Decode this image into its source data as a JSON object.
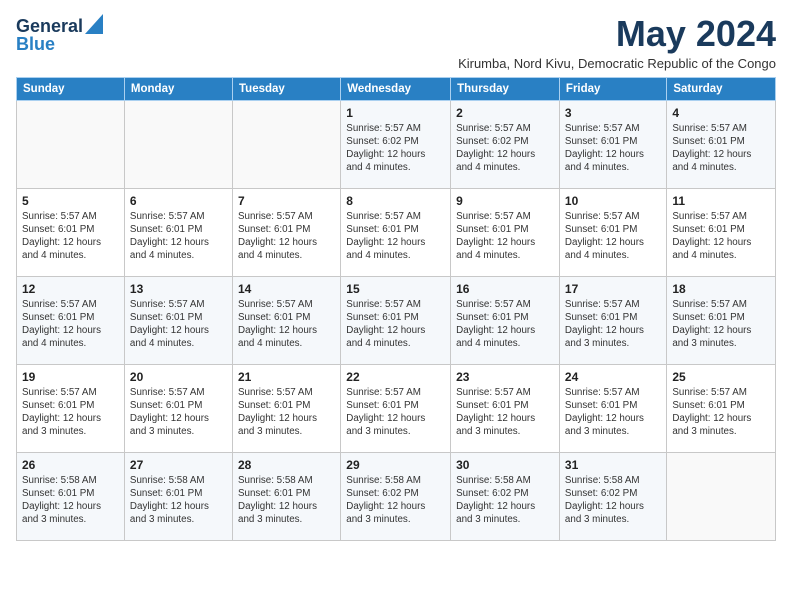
{
  "logo": {
    "general": "General",
    "blue": "Blue"
  },
  "title": "May 2024",
  "location": "Kirumba, Nord Kivu, Democratic Republic of the Congo",
  "days_of_week": [
    "Sunday",
    "Monday",
    "Tuesday",
    "Wednesday",
    "Thursday",
    "Friday",
    "Saturday"
  ],
  "weeks": [
    [
      {
        "day": "",
        "info": ""
      },
      {
        "day": "",
        "info": ""
      },
      {
        "day": "",
        "info": ""
      },
      {
        "day": "1",
        "info": "Sunrise: 5:57 AM\nSunset: 6:02 PM\nDaylight: 12 hours\nand 4 minutes."
      },
      {
        "day": "2",
        "info": "Sunrise: 5:57 AM\nSunset: 6:02 PM\nDaylight: 12 hours\nand 4 minutes."
      },
      {
        "day": "3",
        "info": "Sunrise: 5:57 AM\nSunset: 6:01 PM\nDaylight: 12 hours\nand 4 minutes."
      },
      {
        "day": "4",
        "info": "Sunrise: 5:57 AM\nSunset: 6:01 PM\nDaylight: 12 hours\nand 4 minutes."
      }
    ],
    [
      {
        "day": "5",
        "info": "Sunrise: 5:57 AM\nSunset: 6:01 PM\nDaylight: 12 hours\nand 4 minutes."
      },
      {
        "day": "6",
        "info": "Sunrise: 5:57 AM\nSunset: 6:01 PM\nDaylight: 12 hours\nand 4 minutes."
      },
      {
        "day": "7",
        "info": "Sunrise: 5:57 AM\nSunset: 6:01 PM\nDaylight: 12 hours\nand 4 minutes."
      },
      {
        "day": "8",
        "info": "Sunrise: 5:57 AM\nSunset: 6:01 PM\nDaylight: 12 hours\nand 4 minutes."
      },
      {
        "day": "9",
        "info": "Sunrise: 5:57 AM\nSunset: 6:01 PM\nDaylight: 12 hours\nand 4 minutes."
      },
      {
        "day": "10",
        "info": "Sunrise: 5:57 AM\nSunset: 6:01 PM\nDaylight: 12 hours\nand 4 minutes."
      },
      {
        "day": "11",
        "info": "Sunrise: 5:57 AM\nSunset: 6:01 PM\nDaylight: 12 hours\nand 4 minutes."
      }
    ],
    [
      {
        "day": "12",
        "info": "Sunrise: 5:57 AM\nSunset: 6:01 PM\nDaylight: 12 hours\nand 4 minutes."
      },
      {
        "day": "13",
        "info": "Sunrise: 5:57 AM\nSunset: 6:01 PM\nDaylight: 12 hours\nand 4 minutes."
      },
      {
        "day": "14",
        "info": "Sunrise: 5:57 AM\nSunset: 6:01 PM\nDaylight: 12 hours\nand 4 minutes."
      },
      {
        "day": "15",
        "info": "Sunrise: 5:57 AM\nSunset: 6:01 PM\nDaylight: 12 hours\nand 4 minutes."
      },
      {
        "day": "16",
        "info": "Sunrise: 5:57 AM\nSunset: 6:01 PM\nDaylight: 12 hours\nand 4 minutes."
      },
      {
        "day": "17",
        "info": "Sunrise: 5:57 AM\nSunset: 6:01 PM\nDaylight: 12 hours\nand 3 minutes."
      },
      {
        "day": "18",
        "info": "Sunrise: 5:57 AM\nSunset: 6:01 PM\nDaylight: 12 hours\nand 3 minutes."
      }
    ],
    [
      {
        "day": "19",
        "info": "Sunrise: 5:57 AM\nSunset: 6:01 PM\nDaylight: 12 hours\nand 3 minutes."
      },
      {
        "day": "20",
        "info": "Sunrise: 5:57 AM\nSunset: 6:01 PM\nDaylight: 12 hours\nand 3 minutes."
      },
      {
        "day": "21",
        "info": "Sunrise: 5:57 AM\nSunset: 6:01 PM\nDaylight: 12 hours\nand 3 minutes."
      },
      {
        "day": "22",
        "info": "Sunrise: 5:57 AM\nSunset: 6:01 PM\nDaylight: 12 hours\nand 3 minutes."
      },
      {
        "day": "23",
        "info": "Sunrise: 5:57 AM\nSunset: 6:01 PM\nDaylight: 12 hours\nand 3 minutes."
      },
      {
        "day": "24",
        "info": "Sunrise: 5:57 AM\nSunset: 6:01 PM\nDaylight: 12 hours\nand 3 minutes."
      },
      {
        "day": "25",
        "info": "Sunrise: 5:57 AM\nSunset: 6:01 PM\nDaylight: 12 hours\nand 3 minutes."
      }
    ],
    [
      {
        "day": "26",
        "info": "Sunrise: 5:58 AM\nSunset: 6:01 PM\nDaylight: 12 hours\nand 3 minutes."
      },
      {
        "day": "27",
        "info": "Sunrise: 5:58 AM\nSunset: 6:01 PM\nDaylight: 12 hours\nand 3 minutes."
      },
      {
        "day": "28",
        "info": "Sunrise: 5:58 AM\nSunset: 6:01 PM\nDaylight: 12 hours\nand 3 minutes."
      },
      {
        "day": "29",
        "info": "Sunrise: 5:58 AM\nSunset: 6:02 PM\nDaylight: 12 hours\nand 3 minutes."
      },
      {
        "day": "30",
        "info": "Sunrise: 5:58 AM\nSunset: 6:02 PM\nDaylight: 12 hours\nand 3 minutes."
      },
      {
        "day": "31",
        "info": "Sunrise: 5:58 AM\nSunset: 6:02 PM\nDaylight: 12 hours\nand 3 minutes."
      },
      {
        "day": "",
        "info": ""
      }
    ]
  ]
}
